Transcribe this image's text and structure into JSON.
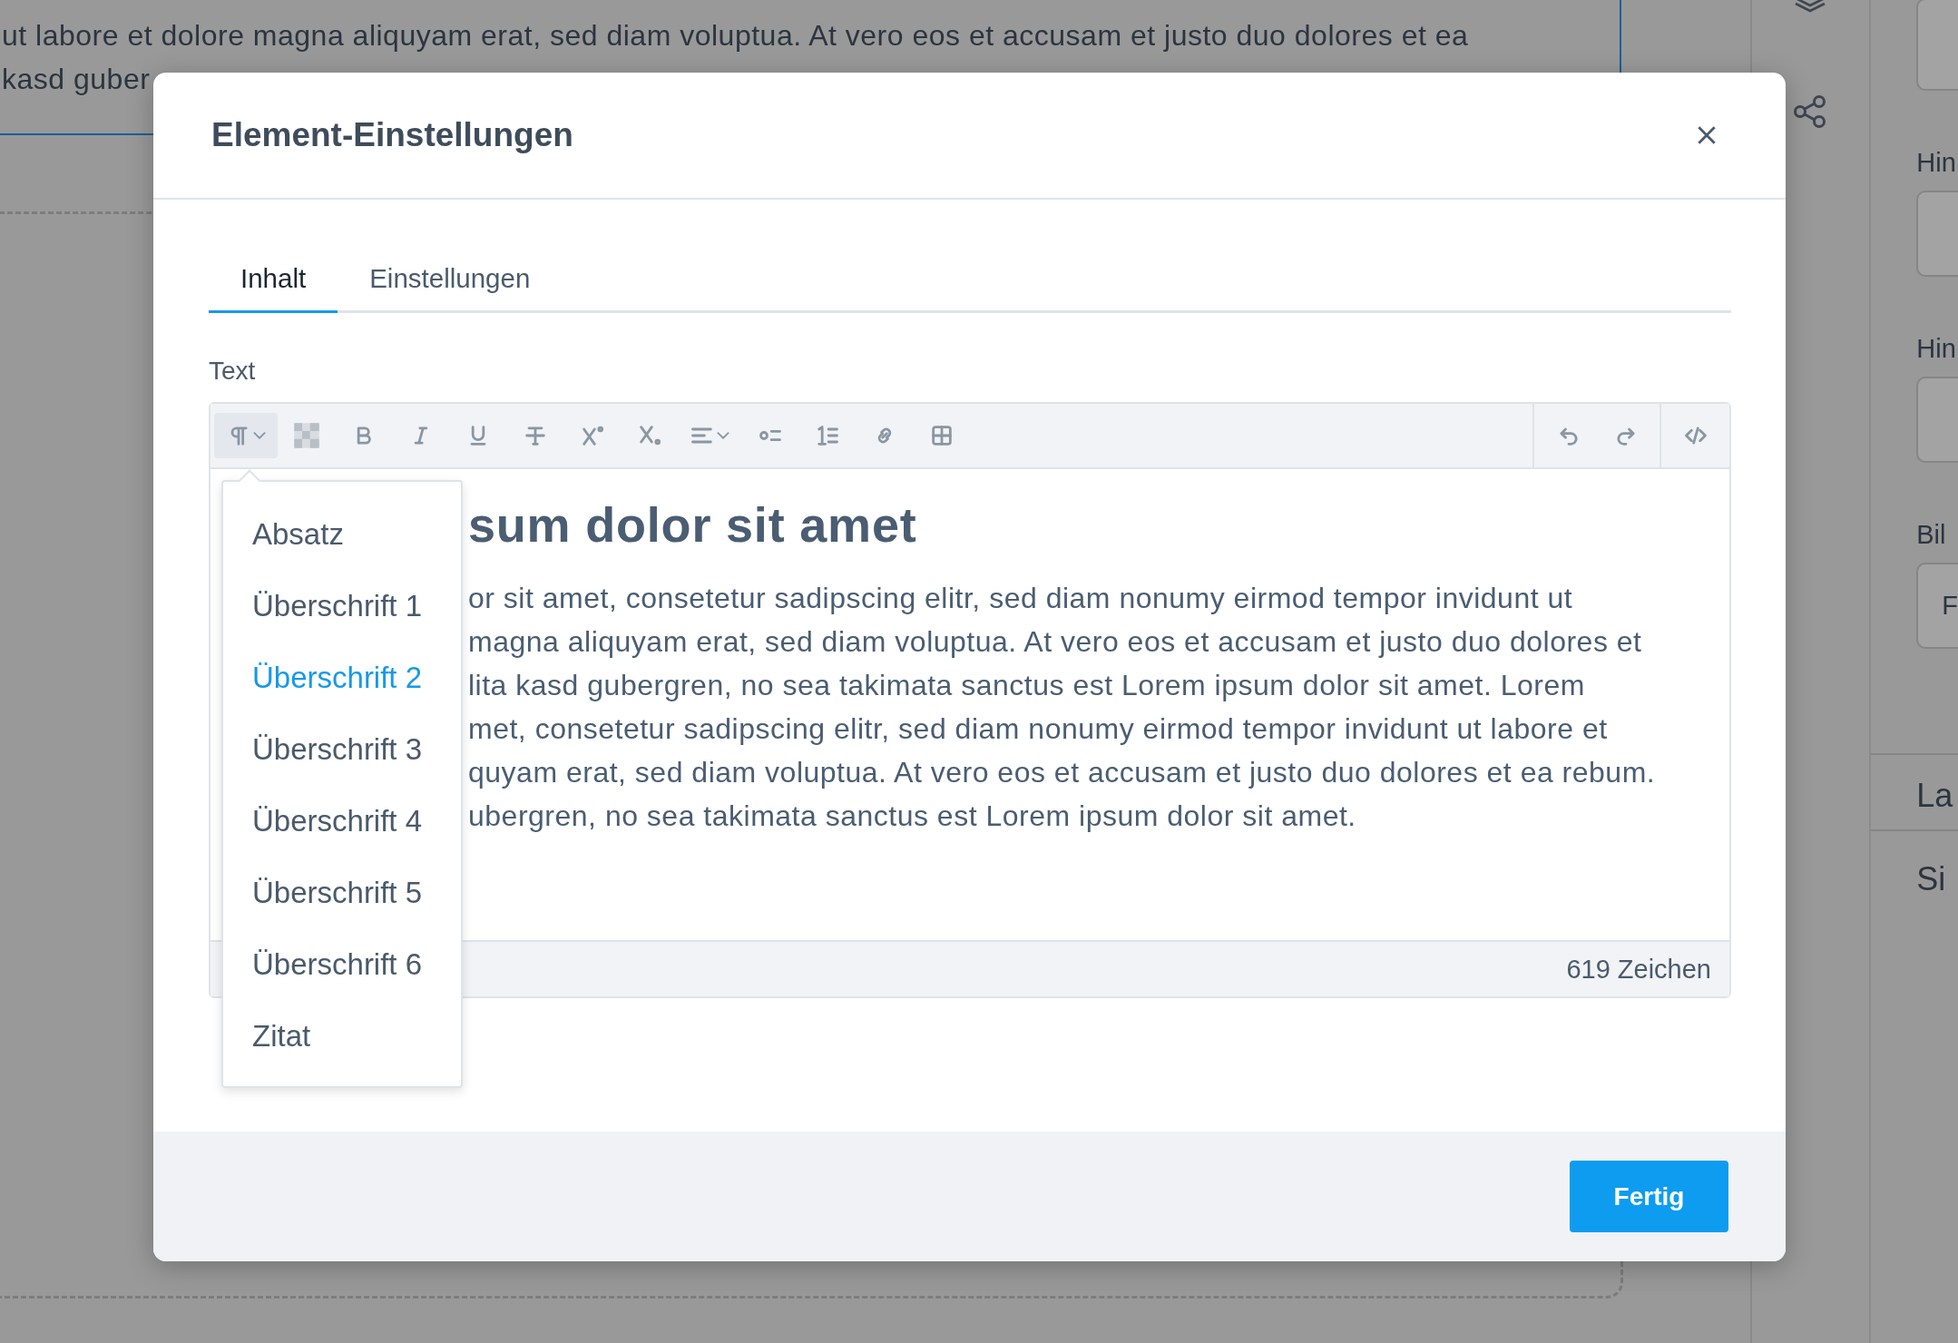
{
  "background_page": {
    "text_lines": [
      "ut labore et dolore magna aliquyam erat, sed diam voluptua. At vero eos et accusam et justo duo dolores et ea",
      "kasd guber"
    ],
    "panel": {
      "labels": [
        "Hin",
        "Hin",
        "Bil"
      ],
      "button_text": "F",
      "sections": [
        "La",
        "Si"
      ]
    }
  },
  "dialog": {
    "title": "Element-Einstellungen",
    "tabs": [
      {
        "label": "Inhalt",
        "selected": true
      },
      {
        "label": "Einstellungen",
        "selected": false
      }
    ],
    "field_label": "Text",
    "toolbar": {
      "format": [
        {
          "kind": "paragraph",
          "expanded": true
        },
        {
          "kind": "color"
        },
        {
          "kind": "bold"
        },
        {
          "kind": "italic"
        },
        {
          "kind": "underline"
        },
        {
          "kind": "strikethrough"
        },
        {
          "kind": "superscript"
        },
        {
          "kind": "subscript"
        },
        {
          "kind": "align"
        },
        {
          "kind": "bullet-list"
        },
        {
          "kind": "numbered-list"
        },
        {
          "kind": "link"
        },
        {
          "kind": "table"
        }
      ],
      "history": [
        {
          "kind": "undo"
        },
        {
          "kind": "redo"
        }
      ],
      "source": [
        {
          "kind": "code"
        }
      ]
    },
    "editor": {
      "heading": "sum dolor sit amet",
      "lines": [
        "or sit amet, consetetur sadipscing elitr, sed diam nonumy eirmod tempor invidunt ut",
        "magna aliquyam erat, sed diam voluptua. At vero eos et accusam et justo duo dolores et",
        "lita kasd gubergren, no sea takimata sanctus est Lorem ipsum dolor sit amet. Lorem",
        "met, consetetur sadipscing elitr, sed diam nonumy eirmod tempor invidunt ut labore et",
        "quyam erat, sed diam voluptua. At vero eos et accusam et justo duo dolores et ea rebum.",
        "ubergren, no sea takimata sanctus est Lorem ipsum dolor sit amet."
      ]
    },
    "character_count": "619 Zeichen",
    "format_menu": {
      "items": [
        {
          "label": "Absatz",
          "selected": false
        },
        {
          "label": "Überschrift 1",
          "selected": false
        },
        {
          "label": "Überschrift 2",
          "selected": true
        },
        {
          "label": "Überschrift 3",
          "selected": false
        },
        {
          "label": "Überschrift 4",
          "selected": false
        },
        {
          "label": "Überschrift 5",
          "selected": false
        },
        {
          "label": "Überschrift 6",
          "selected": false
        },
        {
          "label": "Zitat",
          "selected": false
        }
      ]
    },
    "done_button": "Fertig"
  }
}
